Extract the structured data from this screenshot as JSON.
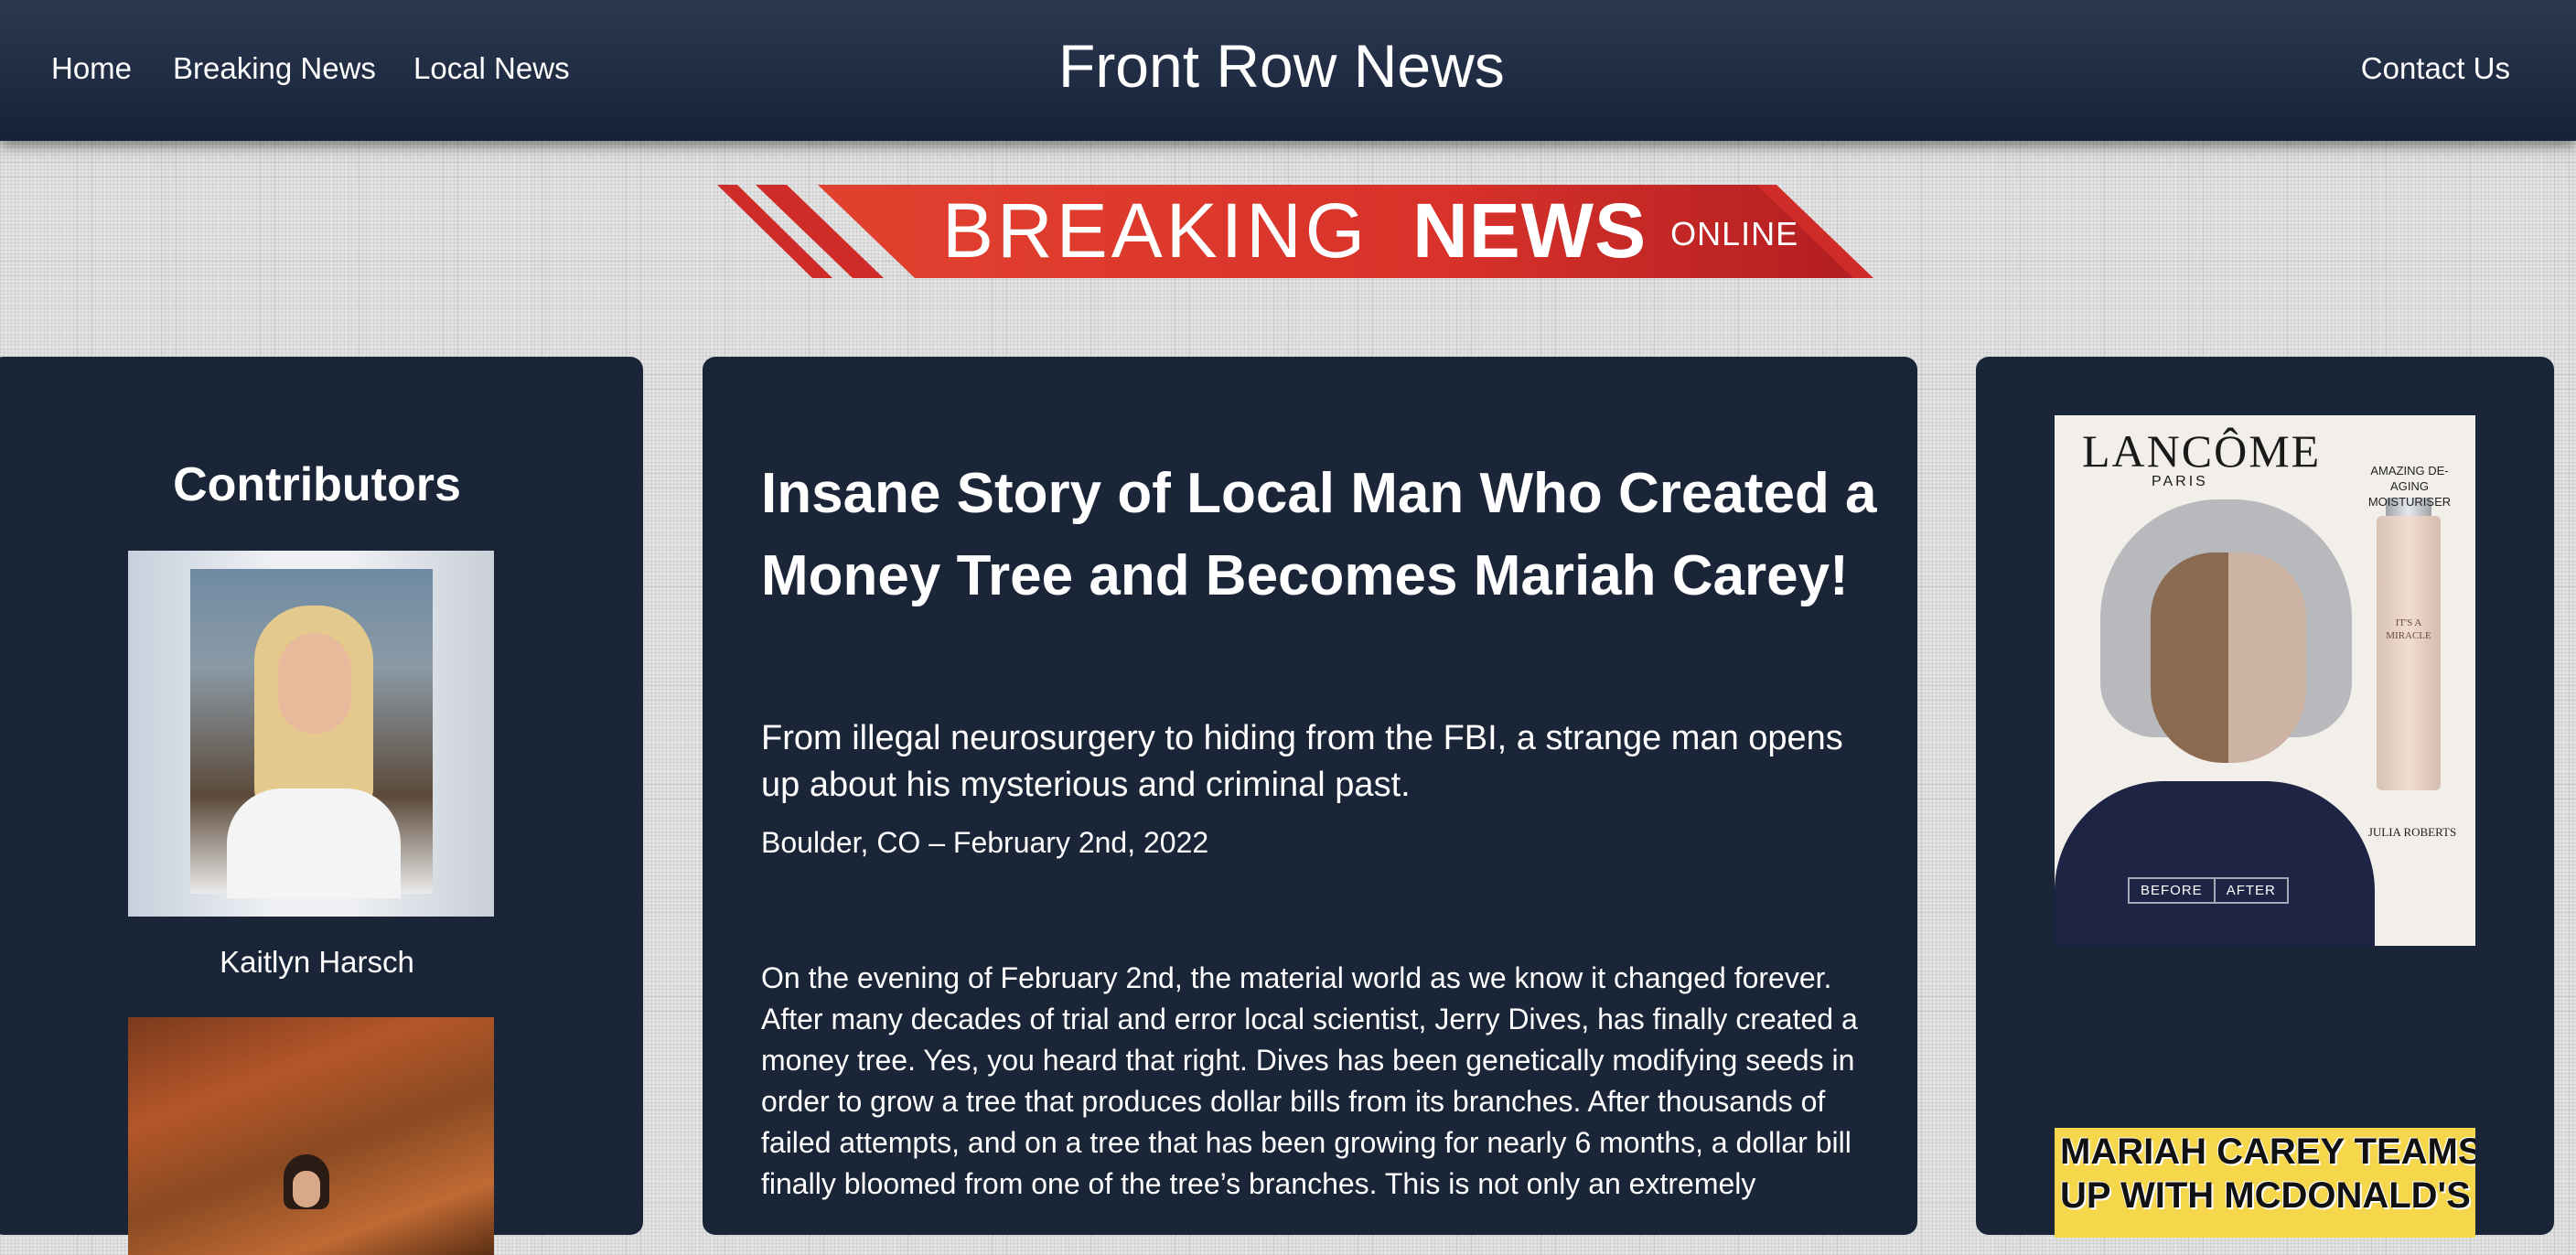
{
  "nav": {
    "links": [
      "Home",
      "Breaking News",
      "Local News"
    ],
    "site_title": "Front Row News",
    "contact": "Contact Us"
  },
  "banner": {
    "word1": "BREAKING",
    "word2": "NEWS",
    "word3": "ONLINE",
    "color": "#d9312b"
  },
  "sidebar": {
    "heading": "Contributors",
    "contributors": [
      {
        "name": "Kaitlyn Harsch"
      }
    ]
  },
  "article": {
    "headline": "Insane Story of Local Man Who Created a Money Tree and Becomes Mariah Carey!",
    "subhead": "From illegal neurosurgery to hiding from the FBI, a strange man opens up about his mysterious and criminal past.",
    "dateline": "Boulder, CO – February 2nd, 2022",
    "body": "On the evening of February 2nd, the material world as we know it changed forever. After many decades of trial and error local scientist, Jerry Dives, has finally created a money tree. Yes, you heard that right. Dives has been genetically modifying seeds in order to grow a tree that produces dollar bills from its branches. After thousands of failed attempts, and on a tree that has been growing for nearly 6 months, a dollar bill finally bloomed from one of the tree’s branches. This is not only an extremely"
  },
  "ads": {
    "lancome": {
      "brand": "LANCÔME",
      "city": "PARIS",
      "tagline": "AMAZING DE-AGING MOISTURISER",
      "bottle_label": "IT'S A MIRACLE",
      "name": "JULIA ROBERTS",
      "before": "BEFORE",
      "after": "AFTER"
    },
    "mariah": {
      "line1": "MARIAH CAREY TEAMS",
      "line2": "UP WITH MCDONALD'S"
    }
  },
  "colors": {
    "navbar": "#1d2840",
    "panel": "#1b2538",
    "text": "#ffffff"
  }
}
